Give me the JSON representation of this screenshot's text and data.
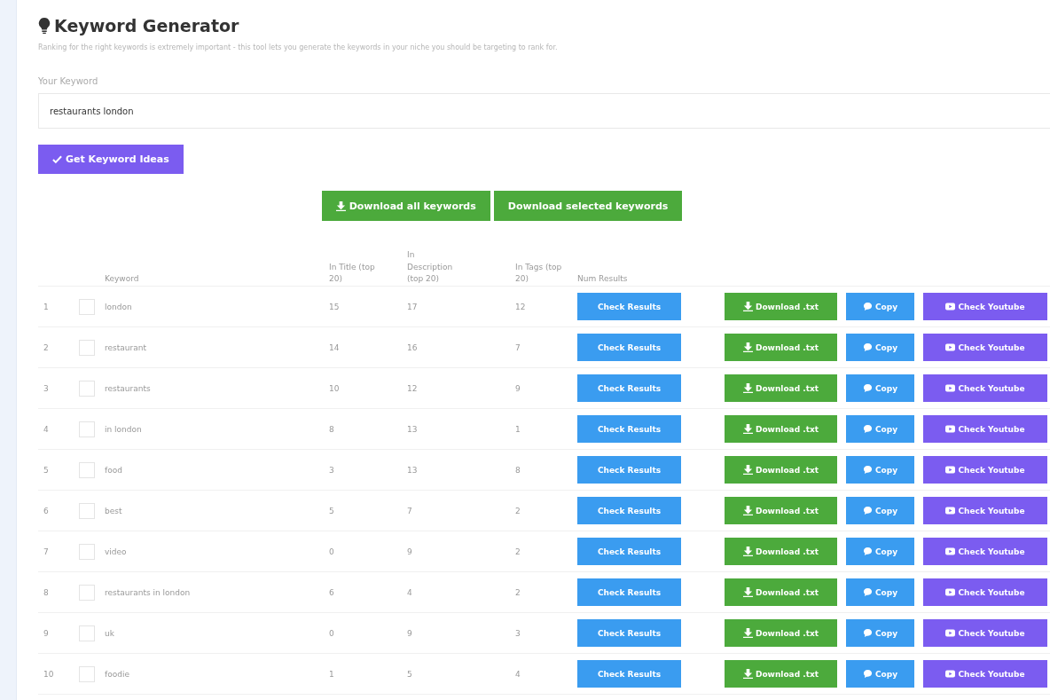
{
  "title": "Keyword Generator",
  "subtitle": "Ranking for the right keywords is extremely important - this tool lets you generate the keywords in your niche you should be targeting to rank for.",
  "keyword_field": {
    "label": "Your Keyword",
    "value": "restaurants london"
  },
  "generate_button": "Get Keyword Ideas",
  "download_buttons": [
    {
      "kind": "all",
      "label": "Download all keywords"
    },
    {
      "kind": "selected",
      "label": "Download selected keywords"
    }
  ],
  "table": {
    "columns": [
      "Keyword",
      "In Title (top 20)",
      "In Description (top 20)",
      "In Tags (top 20)",
      "Num Results"
    ],
    "rows": [
      {
        "number": "1",
        "selected": false,
        "keyword": "london",
        "in_title": "15",
        "in_description": "17",
        "in_tags": "12",
        "check_button": "Check Results",
        "download_button": "Download .txt",
        "copy_button": "Copy",
        "youtube_button": "Check Youtube"
      },
      {
        "number": "2",
        "selected": false,
        "keyword": "restaurant",
        "in_title": "14",
        "in_description": "16",
        "in_tags": "7",
        "check_button": "Check Results",
        "download_button": "Download .txt",
        "copy_button": "Copy",
        "youtube_button": "Check Youtube"
      },
      {
        "number": "3",
        "selected": false,
        "keyword": "restaurants",
        "in_title": "10",
        "in_description": "12",
        "in_tags": "9",
        "check_button": "Check Results",
        "download_button": "Download .txt",
        "copy_button": "Copy",
        "youtube_button": "Check Youtube"
      },
      {
        "number": "4",
        "selected": false,
        "keyword": "in london",
        "in_title": "8",
        "in_description": "13",
        "in_tags": "1",
        "check_button": "Check Results",
        "download_button": "Download .txt",
        "copy_button": "Copy",
        "youtube_button": "Check Youtube"
      },
      {
        "number": "5",
        "selected": false,
        "keyword": "food",
        "in_title": "3",
        "in_description": "13",
        "in_tags": "8",
        "check_button": "Check Results",
        "download_button": "Download .txt",
        "copy_button": "Copy",
        "youtube_button": "Check Youtube"
      },
      {
        "number": "6",
        "selected": false,
        "keyword": "best",
        "in_title": "5",
        "in_description": "7",
        "in_tags": "2",
        "check_button": "Check Results",
        "download_button": "Download .txt",
        "copy_button": "Copy",
        "youtube_button": "Check Youtube"
      },
      {
        "number": "7",
        "selected": false,
        "keyword": "video",
        "in_title": "0",
        "in_description": "9",
        "in_tags": "2",
        "check_button": "Check Results",
        "download_button": "Download .txt",
        "copy_button": "Copy",
        "youtube_button": "Check Youtube"
      },
      {
        "number": "8",
        "selected": false,
        "keyword": "restaurants in london",
        "in_title": "6",
        "in_description": "4",
        "in_tags": "2",
        "check_button": "Check Results",
        "download_button": "Download .txt",
        "copy_button": "Copy",
        "youtube_button": "Check Youtube"
      },
      {
        "number": "9",
        "selected": false,
        "keyword": "uk",
        "in_title": "0",
        "in_description": "9",
        "in_tags": "3",
        "check_button": "Check Results",
        "download_button": "Download .txt",
        "copy_button": "Copy",
        "youtube_button": "Check Youtube"
      },
      {
        "number": "10",
        "selected": false,
        "keyword": "foodie",
        "in_title": "1",
        "in_description": "5",
        "in_tags": "4",
        "check_button": "Check Results",
        "download_button": "Download .txt",
        "copy_button": "Copy",
        "youtube_button": "Check Youtube"
      }
    ]
  }
}
